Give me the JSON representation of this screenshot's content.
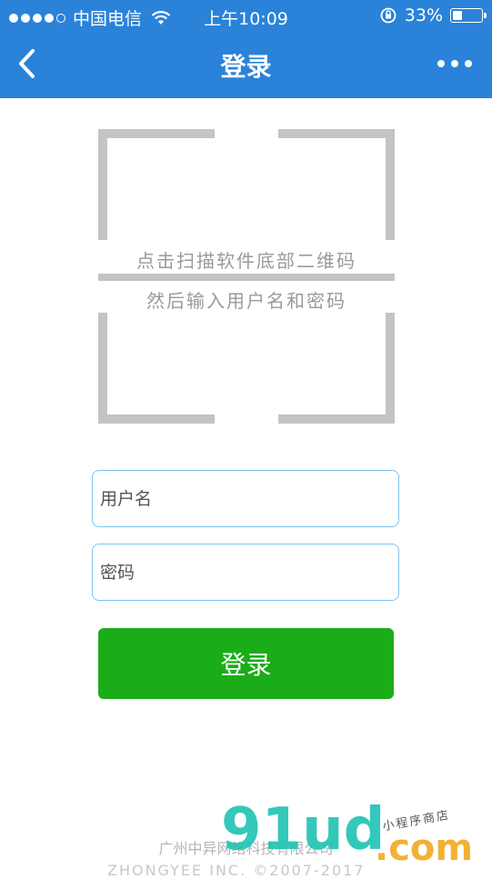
{
  "status_bar": {
    "carrier": "中国电信",
    "time": "上午10:09",
    "battery_percent": "33%",
    "battery_level": 0.33,
    "signal_dots_filled": 4,
    "signal_dots_total": 5,
    "icons": [
      "signal-dots-icon",
      "wifi-icon",
      "rotation-lock-icon",
      "battery-icon"
    ]
  },
  "nav": {
    "title": "登录",
    "back_icon": "chevron-left-icon",
    "more_icon": "more-dots-icon",
    "bar_color": "#2a83d8"
  },
  "scanner": {
    "hint_line1": "点击扫描软件底部二维码",
    "hint_line2": "然后输入用户名和密码",
    "frame_color": "#c4c4c4"
  },
  "form": {
    "username_placeholder": "用户名",
    "username_value": "",
    "password_placeholder": "密码",
    "password_value": "",
    "submit_label": "登录",
    "submit_color": "#1aad19",
    "field_border_color": "#7ec2ef"
  },
  "footer": {
    "company": "广州中异网络科技有限公司",
    "copyright": "ZHONGYEE INC. ©2007-2017"
  },
  "watermark": {
    "main": "91ud",
    "suffix": ".com",
    "side": "小程序商店"
  }
}
